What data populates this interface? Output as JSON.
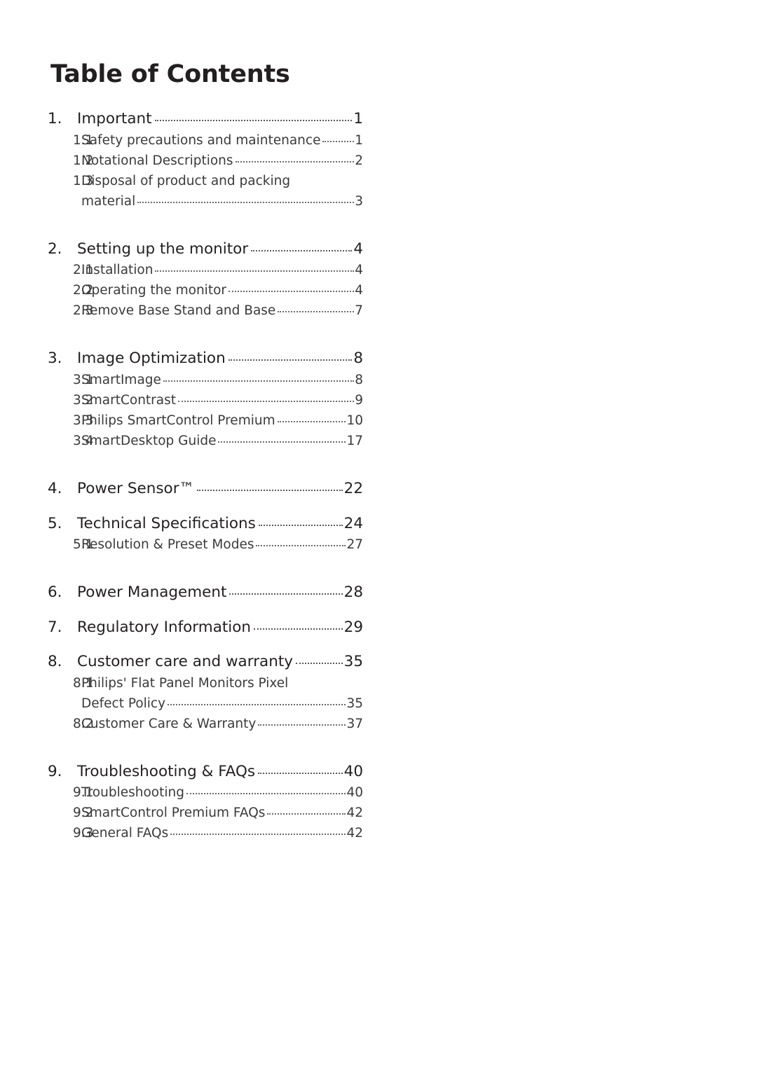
{
  "document": {
    "title": "Table of Contents"
  },
  "toc": {
    "sections": [
      {
        "number": "1.",
        "label": "Important",
        "page": "1",
        "subs": [
          {
            "number": "1.1",
            "label": "Safety precautions and maintenance",
            "page": "1"
          },
          {
            "number": "1.2",
            "label": "Notational Descriptions",
            "page": "2"
          },
          {
            "number": "1.3",
            "label": "Disposal of product and packing",
            "page": "",
            "wrap": "material",
            "wrap_page": "3"
          }
        ]
      },
      {
        "number": "2.",
        "label": "Setting up the monitor",
        "page": "4",
        "subs": [
          {
            "number": "2.1",
            "label": "Installation",
            "page": "4"
          },
          {
            "number": "2.2",
            "label": "Operating the monitor",
            "page": "4"
          },
          {
            "number": "2.3",
            "label": "Remove Base Stand and Base",
            "page": "7"
          }
        ]
      },
      {
        "number": "3.",
        "label": "Image Optimization",
        "page": "8",
        "subs": [
          {
            "number": "3.1",
            "label": "SmartImage",
            "page": "8"
          },
          {
            "number": "3.2",
            "label": "SmartContrast",
            "page": "9"
          },
          {
            "number": "3.3",
            "label": "Philips SmartControl Premium",
            "page": "10"
          },
          {
            "number": "3.4",
            "label": "SmartDesktop Guide",
            "page": "17"
          }
        ]
      },
      {
        "number": "4.",
        "label": "Power Sensor™",
        "page": "22",
        "subs": []
      },
      {
        "number": "5.",
        "label": "Technical Specifications",
        "page": "24",
        "subs": [
          {
            "number": "5.1",
            "label": "Resolution & Preset Modes",
            "page": "27"
          }
        ]
      },
      {
        "number": "6.",
        "label": "Power Management",
        "page": "28",
        "subs": []
      },
      {
        "number": "7.",
        "label": "Regulatory Information",
        "page": "29",
        "subs": []
      },
      {
        "number": "8.",
        "label": "Customer care and warranty",
        "page": "35",
        "subs": [
          {
            "number": "8.1",
            "label": "Philips' Flat Panel Monitors Pixel",
            "page": "",
            "wrap": "Defect Policy",
            "wrap_page": "35"
          },
          {
            "number": "8.2",
            "label": "Customer Care & Warranty",
            "page": "37"
          }
        ]
      },
      {
        "number": "9.",
        "label": "Troubleshooting & FAQs",
        "page": "40",
        "subs": [
          {
            "number": "9.1",
            "label": "Troubleshooting",
            "page": "40"
          },
          {
            "number": "9.2",
            "label": "SmartControl Premium FAQs",
            "page": "42"
          },
          {
            "number": "9.3",
            "label": "General FAQs",
            "page": "42"
          }
        ]
      }
    ]
  }
}
